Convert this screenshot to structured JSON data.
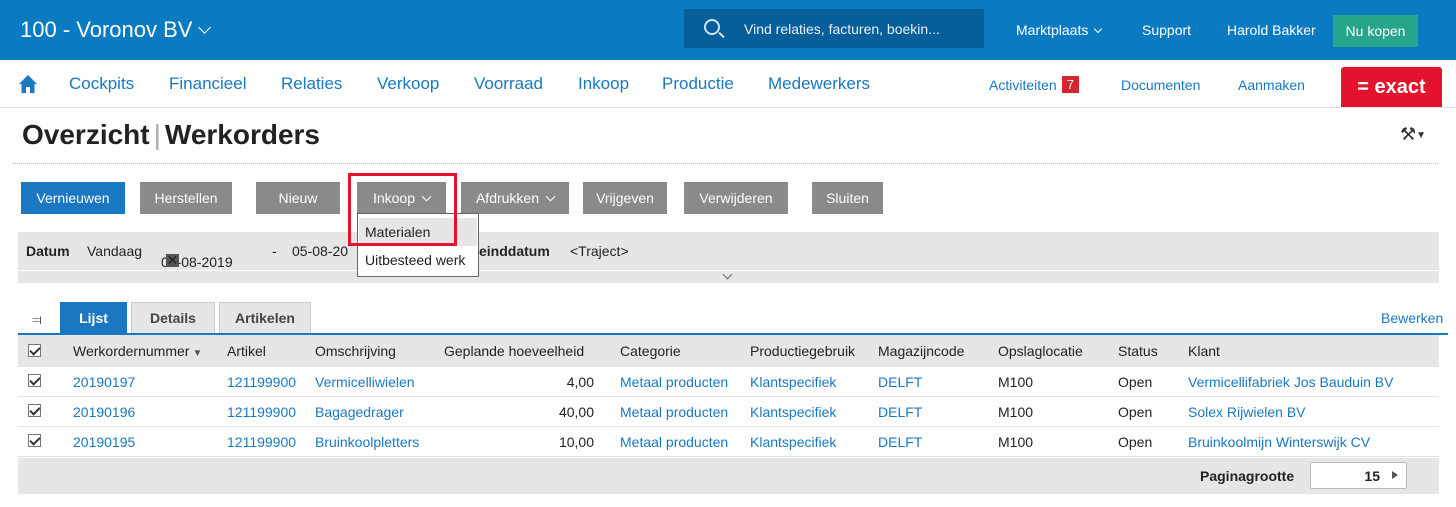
{
  "topbar": {
    "company": "100 - Voronov BV",
    "search_placeholder": "Vind relaties, facturen, boekin...",
    "marktplaats": "Marktplaats",
    "support": "Support",
    "user": "Harold Bakker",
    "buy": "Nu kopen",
    "accent": "#0b7bc1"
  },
  "nav": {
    "items": [
      "Cockpits",
      "Financieel",
      "Relaties",
      "Verkoop",
      "Voorraad",
      "Inkoop",
      "Productie",
      "Medewerkers"
    ],
    "activiteiten": "Activiteiten",
    "activiteiten_count": "7",
    "documenten": "Documenten",
    "aanmaken": "Aanmaken",
    "logo": "= exact"
  },
  "page": {
    "title_left": "Overzicht",
    "title_sep": "|",
    "title_right": "Werkorders"
  },
  "toolbar": {
    "vernieuwen": "Vernieuwen",
    "herstellen": "Herstellen",
    "nieuw": "Nieuw",
    "inkoop": "Inkoop",
    "afdrukken": "Afdrukken",
    "vrijgeven": "Vrijgeven",
    "verwijderen": "Verwijderen",
    "sluiten": "Sluiten"
  },
  "inkoop_menu": [
    "Materialen",
    "Uitbesteed werk"
  ],
  "filter": {
    "datum_label": "Datum",
    "datum_mode": "Vandaag",
    "date_from": "05-08-2019",
    "dash": "-",
    "date_to": "05-08-20",
    "einddatum_label": "einddatum",
    "traject": "<Traject>"
  },
  "tabs": {
    "lijst": "Lijst",
    "details": "Details",
    "artikelen": "Artikelen",
    "bewerken": "Bewerken"
  },
  "table": {
    "headers": [
      "Werkordernummer",
      "Artikel",
      "Omschrijving",
      "Geplande hoeveelheid",
      "Categorie",
      "Productiegebruik",
      "Magazijncode",
      "Opslaglocatie",
      "Status",
      "Klant"
    ],
    "rows": [
      {
        "nr": "20190197",
        "artikel": "121199900",
        "omschrijving": "Vermicelliwielen",
        "hoeveelheid": "4,00",
        "categorie": "Metaal producten",
        "gebruik": "Klantspecifiek",
        "magazijn": "DELFT",
        "locatie": "M100",
        "status": "Open",
        "klant": "Vermicellifabriek Jos Bauduin BV"
      },
      {
        "nr": "20190196",
        "artikel": "121199900",
        "omschrijving": "Bagagedrager",
        "hoeveelheid": "40,00",
        "categorie": "Metaal producten",
        "gebruik": "Klantspecifiek",
        "magazijn": "DELFT",
        "locatie": "M100",
        "status": "Open",
        "klant": "Solex Rijwielen BV"
      },
      {
        "nr": "20190195",
        "artikel": "121199900",
        "omschrijving": "Bruinkoolpletters",
        "hoeveelheid": "10,00",
        "categorie": "Metaal producten",
        "gebruik": "Klantspecifiek",
        "magazijn": "DELFT",
        "locatie": "M100",
        "status": "Open",
        "klant": "Bruinkoolmijn Winterswijk CV"
      }
    ]
  },
  "footer": {
    "paginagrootte_label": "Paginagrootte",
    "paginagrootte_value": "15"
  }
}
